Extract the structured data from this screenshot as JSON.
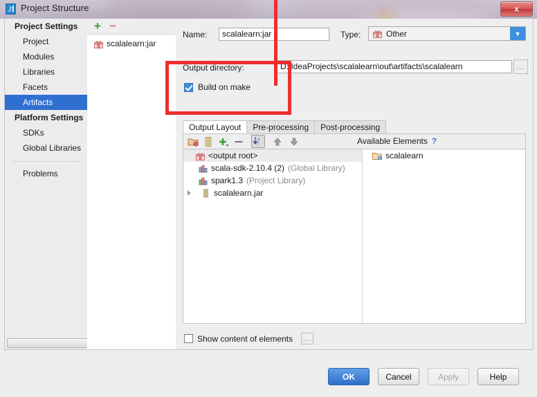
{
  "window": {
    "title": "Project Structure",
    "app_icon": "intellij-idea-icon",
    "close_label": "x"
  },
  "sidebar": {
    "sections": [
      {
        "header": "Project Settings",
        "items": [
          {
            "label": "Project",
            "selected": false
          },
          {
            "label": "Modules",
            "selected": false
          },
          {
            "label": "Libraries",
            "selected": false
          },
          {
            "label": "Facets",
            "selected": false
          },
          {
            "label": "Artifacts",
            "selected": true
          }
        ]
      },
      {
        "header": "Platform Settings",
        "items": [
          {
            "label": "SDKs",
            "selected": false
          },
          {
            "label": "Global Libraries",
            "selected": false
          }
        ]
      }
    ],
    "problems_label": "Problems",
    "scrollbar": "horizontal-scrollbar"
  },
  "artifact_list": {
    "add_label": "+",
    "remove_label": "−",
    "items": [
      {
        "label": "scalalearn:jar",
        "icon": "artifact-icon"
      }
    ]
  },
  "form": {
    "name_label": "Name:",
    "name_mnemonic": "a",
    "name_value": "scalalearn:jar",
    "type_label": "Type:",
    "type_value": "Other",
    "type_icon": "artifact-icon",
    "output_dir_label": "Output directory:",
    "output_dir_value": "D:\\IdeaProjects\\scalalearn\\out\\artifacts\\scalalearn",
    "browse_label": "...",
    "build_on_make_label": "Build on make",
    "build_on_make_mnemonic": "B",
    "build_on_make_checked": true
  },
  "tabs": [
    {
      "label": "Output Layout",
      "active": true
    },
    {
      "label": "Pre-processing",
      "active": false
    },
    {
      "label": "Post-processing",
      "active": false
    }
  ],
  "toolbar": {
    "icons": [
      {
        "name": "add-directory-icon",
        "title": "Create Directory"
      },
      {
        "name": "add-archive-icon",
        "title": "Create Archive"
      },
      {
        "name": "add-copy-icon",
        "title": "Add Copy of"
      },
      {
        "name": "remove-icon",
        "title": "Remove"
      },
      {
        "name": "sort-icon",
        "title": "Sort by Type",
        "active": true
      },
      {
        "name": "move-up-icon",
        "title": "Move Up"
      },
      {
        "name": "move-down-icon",
        "title": "Move Down"
      }
    ]
  },
  "available_elements": {
    "title": "Available Elements",
    "help_label": "?",
    "items": [
      {
        "label": "scalalearn",
        "icon": "folder-icon"
      }
    ]
  },
  "output_tree": {
    "root": {
      "label": "<output root>",
      "icon": "artifact-icon",
      "selected": true
    },
    "children": [
      {
        "label": "scala-sdk-2.10.4 (2)",
        "suffix": "(Global Library)",
        "icon": "library-icon",
        "expandable": false
      },
      {
        "label": "spark1.3",
        "suffix": "(Project Library)",
        "icon": "library-icon",
        "expandable": false
      },
      {
        "label": "scalalearn.jar",
        "suffix": "",
        "icon": "archive-icon",
        "expandable": true
      }
    ]
  },
  "footer": {
    "show_content_label": "Show content of elements",
    "show_content_checked": false,
    "show_content_more": "...",
    "buttons": [
      {
        "label": "OK",
        "style": "primary",
        "enabled": true
      },
      {
        "label": "Cancel",
        "style": "normal",
        "enabled": true
      },
      {
        "label": "Apply",
        "style": "disabled",
        "enabled": false
      },
      {
        "label": "Help",
        "style": "normal",
        "enabled": true
      }
    ]
  },
  "annotation": {
    "shape": "red-rectangle-highlight",
    "color": "#ef2d2d",
    "targets": "Output directory / Build on make"
  },
  "colors": {
    "selection_blue": "#2f6fd0",
    "accent_blue": "#3f8fdf",
    "annotation_red": "#ef2d2d",
    "window_bg": "#efeeee"
  }
}
